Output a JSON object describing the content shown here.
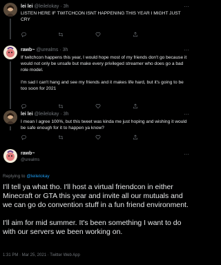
{
  "tweets": [
    {
      "name": "lei lei",
      "handle": "@leilelokay",
      "time": "3h",
      "separator": "·",
      "text": [
        "LISTEN HERE IF TWITCHCON ISNT HAPPENING THIS YEAR I MIGHT JUST CRY"
      ]
    },
    {
      "name": "rawb~",
      "handle": "@urealms",
      "time": "3h",
      "separator": "·",
      "text": [
        "If twitchcon happens this year, I would hope most of my friends don't go because it would not only be unsafe but make every privileged streamer who does go a bad role model.",
        "I'm sad I can't hang and see my friends and it makes life hard, but it's going to be too soon for 2021"
      ]
    },
    {
      "name": "lei lei",
      "handle": "@leilelokay",
      "time": "3h",
      "separator": "·",
      "text": [
        "I mean I agree 100%, but this tweet was kinda me just hoping and wishing it would be safe enough for it to happen ya know?"
      ]
    }
  ],
  "more_glyph": "···",
  "main": {
    "name": "rawb~",
    "handle": "@urealms",
    "replying_to_prefix": "Replying to",
    "replying_to_mention": "@leilelokay",
    "text": [
      "I'll tell ya what tho. I'll host a virtual friendcon in either Minecraft or GTA this year and invite all our mutuals and we can go do convention stuff in a fun friend environment.",
      "I'll aim for mid summer. It's been something I want to do with our servers we been working on."
    ],
    "footer": "1:31 PM · Mar 25, 2021 · Twitter Web App"
  },
  "icons": [
    "reply-icon",
    "retweet-icon",
    "like-icon",
    "share-icon",
    "more-icon"
  ],
  "colors": {
    "background": "#000000",
    "text": "#e7e9ea",
    "muted": "#71767b",
    "accent": "#1d9bf0"
  }
}
